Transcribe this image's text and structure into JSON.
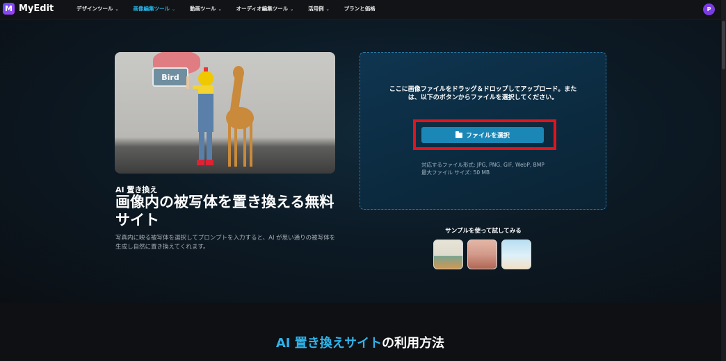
{
  "app": {
    "logo_text": "MyEdit",
    "logo_letter": "M"
  },
  "nav": {
    "items": [
      {
        "label": "デザインツール",
        "active": false
      },
      {
        "label": "画像編集ツール",
        "active": true
      },
      {
        "label": "動画ツール",
        "active": false
      },
      {
        "label": "オーディオ編集ツール",
        "active": false
      },
      {
        "label": "活用例",
        "active": false
      },
      {
        "label": "プランと価格",
        "active": false
      }
    ],
    "avatar_letter": "P"
  },
  "hero": {
    "image_tag": "Bird",
    "subtitle": "AI 置き換え",
    "title": "画像内の被写体を置き換える無料サイト",
    "description": "写真内に映る被写体を選択してプロンプトを入力すると、AI が思い通りの被写体を生成し自然に置き換えてくれます。"
  },
  "upload": {
    "instruction": "ここに画像ファイルをドラッグ＆ドロップしてアップロード。または、以下のボタンからファイルを選択してください。",
    "button_label": "ファイルを選択",
    "formats": "対応するファイル形式: JPG, PNG, GIF, WebP, BMP",
    "max_size": "最大ファイル サイズ: 50 MB"
  },
  "samples": {
    "title": "サンプルを使って試してみる"
  },
  "section": {
    "title_accent": "AI 置き換えサイト",
    "title_rest": "の利用方法"
  },
  "colors": {
    "accent": "#25b7ea",
    "button": "#1a87b6",
    "highlight_frame": "#e1141b"
  }
}
